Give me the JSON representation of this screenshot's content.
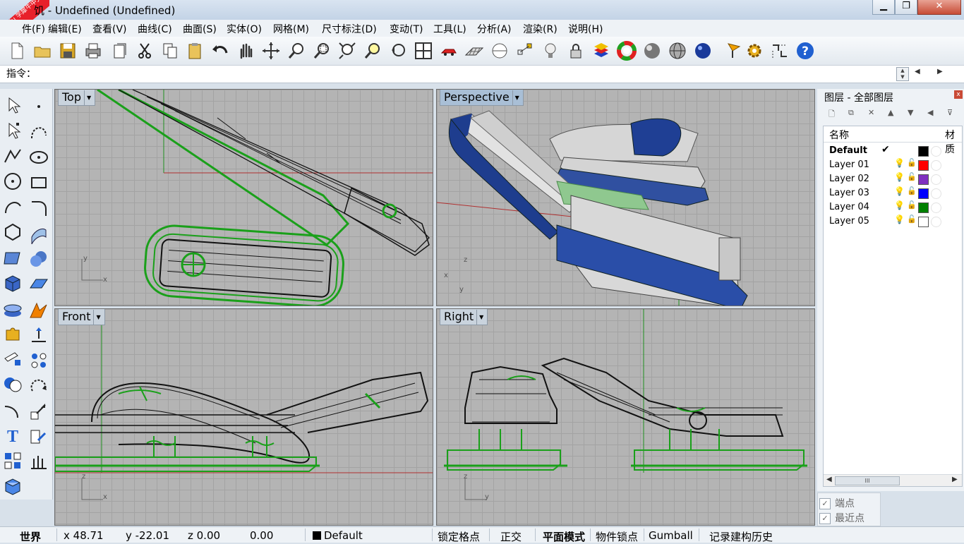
{
  "window": {
    "title": "饥 - Undefined (Undefined)",
    "logo_text": "xuexiniu 学犀牛中文网",
    "minimize": "▁",
    "restore": "❐",
    "close": "✕"
  },
  "menu": [
    "件(F)",
    "编辑(E)",
    "查看(V)",
    "曲线(C)",
    "曲面(S)",
    "实体(O)",
    "网格(M)",
    "尺寸标注(D)",
    "变动(T)",
    "工具(L)",
    "分析(A)",
    "渲染(R)",
    "说明(H)"
  ],
  "toolbar_icons": [
    "new-file-icon",
    "open-folder-icon",
    "save-icon",
    "print-icon",
    "import-icon",
    "cut-icon",
    "copy-icon",
    "paste-icon",
    "undo-icon",
    "pan-hand-icon",
    "rotate-view-icon",
    "zoom-in-icon",
    "zoom-window-icon",
    "zoom-extents-icon",
    "zoom-selected-icon",
    "undo-view-icon",
    "four-viewports-icon",
    "car-icon",
    "grid-plane-icon",
    "snap-icon",
    "osnap-icon",
    "light-bulb-icon",
    "lock-icon",
    "layers-icon",
    "color-wheel-icon",
    "sphere-shaded-icon",
    "wireframe-sphere-icon",
    "render-sphere-icon",
    "flag-icon",
    "gear-icon",
    "dimension-icon",
    "help-icon"
  ],
  "command": {
    "label": "指令：",
    "value": ""
  },
  "viewports": {
    "top": {
      "label": "Top",
      "axis_y": "y",
      "axis_x": "x"
    },
    "perspective": {
      "label": "Perspective",
      "axis_z": "z",
      "axis_x": "x",
      "axis_y": "y"
    },
    "front": {
      "label": "Front",
      "axis_z": "z",
      "axis_x": "x"
    },
    "right": {
      "label": "Right",
      "axis_z": "z",
      "axis_y": "y"
    }
  },
  "layers_panel": {
    "title": "图层 - 全部图层",
    "col_name": "名称",
    "col_material": "材质",
    "close": "x",
    "layers": [
      {
        "name": "Default",
        "current": "✔",
        "color": "#000000"
      },
      {
        "name": "Layer 01",
        "color": "#ff0000"
      },
      {
        "name": "Layer 02",
        "color": "#8030c0"
      },
      {
        "name": "Layer 03",
        "color": "#0000ff"
      },
      {
        "name": "Layer 04",
        "color": "#008000"
      },
      {
        "name": "Layer 05",
        "color": "#ffffff"
      }
    ],
    "scroll_thumb": "III"
  },
  "osnap": {
    "end": "端点",
    "near": "最近点",
    "check": "✓"
  },
  "status": {
    "world": "世界",
    "x": "x 48.71",
    "y": "y -22.01",
    "z": "z 0.00",
    "val": "0.00",
    "layer": "Default",
    "grid_snap": "锁定格点",
    "ortho": "正交",
    "planar": "平面模式",
    "osnap": "物件锁点",
    "gumball": "Gumball",
    "history": "记录建构历史"
  }
}
